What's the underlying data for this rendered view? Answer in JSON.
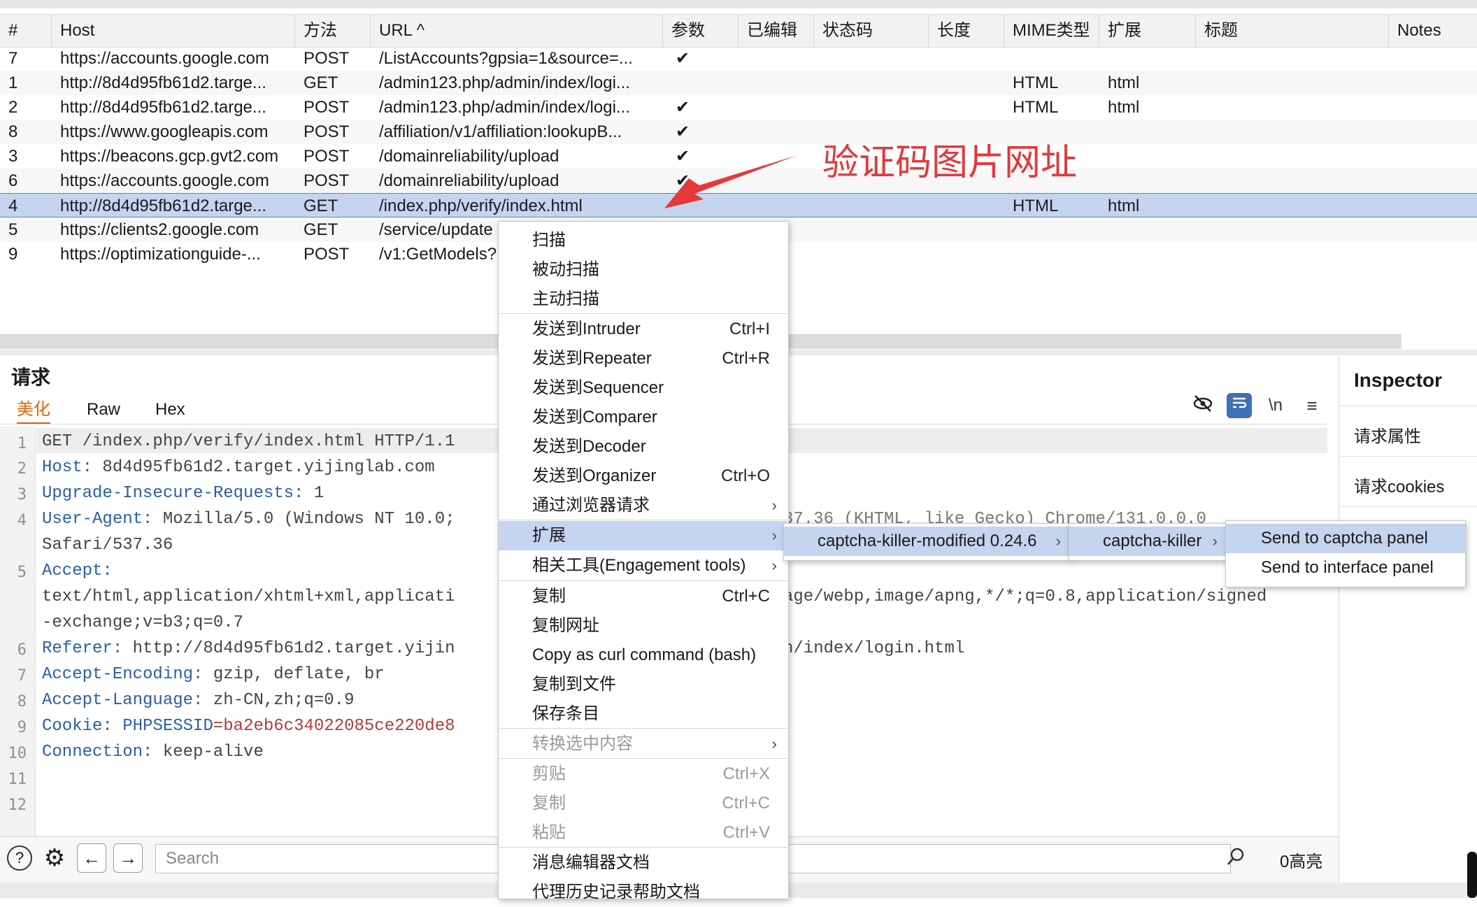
{
  "table": {
    "headers": [
      "#",
      "Host",
      "方法",
      "URL ^",
      "参数",
      "已编辑",
      "状态码",
      "长度",
      "MIME类型",
      "扩展",
      "标题",
      "Notes"
    ],
    "rows": [
      {
        "num": "7",
        "host": "https://accounts.google.com",
        "method": "POST",
        "url": "/ListAccounts?gpsia=1&source=...",
        "params": "✔",
        "mime": "",
        "ext": ""
      },
      {
        "num": "1",
        "host": "http://8d4d95fb61d2.targe...",
        "method": "GET",
        "url": "/admin123.php/admin/index/logi...",
        "params": "",
        "mime": "HTML",
        "ext": "html"
      },
      {
        "num": "2",
        "host": "http://8d4d95fb61d2.targe...",
        "method": "POST",
        "url": "/admin123.php/admin/index/logi...",
        "params": "✔",
        "mime": "HTML",
        "ext": "html"
      },
      {
        "num": "8",
        "host": "https://www.googleapis.com",
        "method": "POST",
        "url": "/affiliation/v1/affiliation:lookupB...",
        "params": "✔",
        "mime": "",
        "ext": ""
      },
      {
        "num": "3",
        "host": "https://beacons.gcp.gvt2.com",
        "method": "POST",
        "url": "/domainreliability/upload",
        "params": "✔",
        "mime": "",
        "ext": ""
      },
      {
        "num": "6",
        "host": "https://accounts.google.com",
        "method": "POST",
        "url": "/domainreliability/upload",
        "params": "✔",
        "mime": "",
        "ext": ""
      },
      {
        "num": "4",
        "host": "http://8d4d95fb61d2.targe...",
        "method": "GET",
        "url": "/index.php/verify/index.html",
        "params": "",
        "mime": "HTML",
        "ext": "html"
      },
      {
        "num": "5",
        "host": "https://clients2.google.com",
        "method": "GET",
        "url": "/service/update",
        "params": "",
        "mime": "",
        "ext": ""
      },
      {
        "num": "9",
        "host": "https://optimizationguide-...",
        "method": "POST",
        "url": "/v1:GetModels?",
        "params": "",
        "mime": "",
        "ext": ""
      }
    ]
  },
  "annotation": "验证码图片网址",
  "request": {
    "title": "请求",
    "tabs": [
      "美化",
      "Raw",
      "Hex"
    ],
    "line_numbers": [
      "1",
      "2",
      "3",
      "4",
      "",
      "5",
      "",
      "",
      "6",
      "7",
      "8",
      "9",
      "10",
      "11",
      "12"
    ],
    "lines": {
      "l1": "GET /index.php/verify/index.html HTTP/1.1",
      "l2k": "Host:",
      "l2v": " 8d4d95fb61d2.target.yijinglab.com",
      "l3k": "Upgrade-Insecure-Requests:",
      "l3v": " 1",
      "l4k": "User-Agent:",
      "l4v": " Mozilla/5.0 (Windows NT 10.0;",
      "l4b": "Safari/537.36",
      "l4r": "37.36 (KHTML, like Gecko) Chrome/131.0.0.0",
      "l5k": "Accept:",
      "l5a": "text/html,application/xhtml+xml,applicati",
      "l5r": "age/webp,image/apng,*/*;q=0.8,application/signed",
      "l5b": "-exchange;v=b3;q=0.7",
      "l6k": "Referer:",
      "l6v": " http://8d4d95fb61d2.target.yijin",
      "l6r": "n/index/login.html",
      "l7k": "Accept-Encoding:",
      "l7v": " gzip, deflate, br",
      "l8k": "Accept-Language:",
      "l8v": " zh-CN,zh;q=0.9",
      "l9k": "Cookie:",
      "l9c1": " PHPSESSID",
      "l9c2": "=ba2eb6c34022085ce220de8",
      "l10k": "Connection:",
      "l10v": " keep-alive"
    }
  },
  "toolbar_icons": [
    "eye-off-icon",
    "wrap-icon",
    "newline-icon",
    "menu-icon"
  ],
  "toolbar_newline": "\\n",
  "inspector": {
    "title": "Inspector",
    "items": [
      "请求属性",
      "请求cookies"
    ]
  },
  "bottom": {
    "search_placeholder": "Search",
    "highlights": "0高亮"
  },
  "context_menu": {
    "items": [
      {
        "label": "扫描",
        "shortcut": ""
      },
      {
        "label": "被动扫描",
        "shortcut": ""
      },
      {
        "label": "主动扫描",
        "shortcut": ""
      },
      {
        "label": "发送到Intruder",
        "shortcut": "Ctrl+I"
      },
      {
        "label": "发送到Repeater",
        "shortcut": "Ctrl+R"
      },
      {
        "label": "发送到Sequencer",
        "shortcut": ""
      },
      {
        "label": "发送到Comparer",
        "shortcut": ""
      },
      {
        "label": "发送到Decoder",
        "shortcut": ""
      },
      {
        "label": "发送到Organizer",
        "shortcut": "Ctrl+O"
      },
      {
        "label": "通过浏览器请求",
        "shortcut": ""
      },
      {
        "label": "扩展",
        "shortcut": ""
      },
      {
        "label": "相关工具(Engagement tools)",
        "shortcut": ""
      },
      {
        "label": "复制",
        "shortcut": "Ctrl+C"
      },
      {
        "label": "复制网址",
        "shortcut": ""
      },
      {
        "label": "Copy as curl command (bash)",
        "shortcut": ""
      },
      {
        "label": "复制到文件",
        "shortcut": ""
      },
      {
        "label": "保存条目",
        "shortcut": ""
      },
      {
        "label": "转换选中内容",
        "shortcut": ""
      },
      {
        "label": "剪贴",
        "shortcut": "Ctrl+X"
      },
      {
        "label": "复制",
        "shortcut": "Ctrl+C"
      },
      {
        "label": "粘贴",
        "shortcut": "Ctrl+V"
      },
      {
        "label": "消息编辑器文档",
        "shortcut": ""
      },
      {
        "label": "代理历史记录帮助文档",
        "shortcut": ""
      }
    ],
    "submenu1": "captcha-killer-modified 0.24.6",
    "submenu2": "captcha-killer",
    "submenu3": [
      "Send to captcha panel",
      "Send to interface panel"
    ]
  }
}
